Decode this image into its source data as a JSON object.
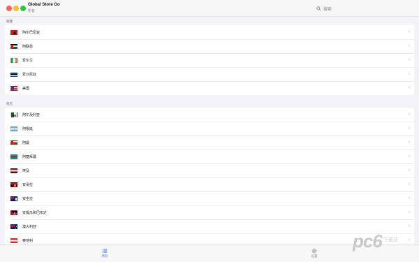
{
  "window": {
    "title": "Global Store Go",
    "subtitle": "所有",
    "search_placeholder": "搜索"
  },
  "sections": [
    {
      "header": "收藏",
      "items": [
        {
          "label": "阿尔巴尼亚",
          "flag": "albania"
        },
        {
          "label": "阿联酋",
          "flag": "uae"
        },
        {
          "label": "爱尔兰",
          "flag": "ireland"
        },
        {
          "label": "爱沙尼亚",
          "flag": "estonia"
        },
        {
          "label": "美国",
          "flag": "usa"
        }
      ]
    },
    {
      "header": "商店",
      "items": [
        {
          "label": "阿尔及利亚",
          "flag": "algeria"
        },
        {
          "label": "阿根廷",
          "flag": "argentina"
        },
        {
          "label": "阿曼",
          "flag": "oman"
        },
        {
          "label": "阿塞拜疆",
          "flag": "azerbaijan"
        },
        {
          "label": "埃及",
          "flag": "egypt"
        },
        {
          "label": "安哥拉",
          "flag": "angola"
        },
        {
          "label": "安圭拉",
          "flag": "anguilla"
        },
        {
          "label": "安提瓜和巴布达",
          "flag": "antigua-barbuda"
        },
        {
          "label": "澳大利亚",
          "flag": "australia"
        },
        {
          "label": "奥地利",
          "flag": "austria"
        }
      ]
    }
  ],
  "tabbar": {
    "all_label": "所有",
    "settings_label": "设置"
  },
  "watermark": {
    "main": "pc6",
    "sub": "下载站"
  },
  "colors": {
    "accent": "#3478f6",
    "background": "#f2f2f7"
  }
}
